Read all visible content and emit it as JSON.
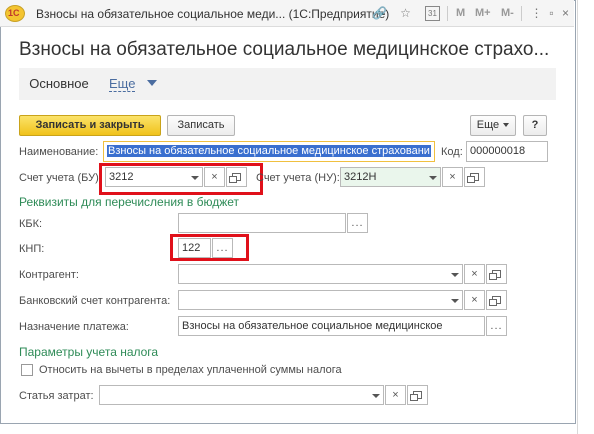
{
  "window": {
    "logo_text": "1С",
    "title": "Взносы на обязательное социальное меди... (1С:Предприятие)",
    "toolbar_m": [
      "M",
      "M+",
      "M-"
    ]
  },
  "form": {
    "title": "Взносы на обязательное социальное медицинское страхо...",
    "tab_main": "Основное",
    "tab_more": "Еще"
  },
  "commands": {
    "save_close": "Записать и закрыть",
    "save": "Записать",
    "more": "Еще",
    "help": "?"
  },
  "fields": {
    "name_label": "Наименование:",
    "name_value": "Взносы на обязательное социальное медицинское страховани",
    "code_label": "Код:",
    "code_value": "000000018",
    "acc_bu_label": "Счет учета (БУ):",
    "acc_bu_value": "3212",
    "acc_nu_label": "Счет учета (НУ):",
    "acc_nu_value": "3212Н",
    "kbk_label": "КБК:",
    "kbk_value": "",
    "knp_label": "КНП:",
    "knp_value": "122",
    "contractor_label": "Контрагент:",
    "contractor_value": "",
    "bank_label": "Банковский счет контрагента:",
    "bank_value": "",
    "purpose_label": "Назначение платежа:",
    "purpose_value": "Взносы на обязательное социальное медицинское",
    "deduct_label": "Относить на вычеты в пределах уплаченной суммы налога",
    "deduct_checked": false,
    "cost_label": "Статья затрат:",
    "cost_value": ""
  },
  "sections": {
    "budget": "Реквизиты для перечисления в бюджет",
    "tax": "Параметры учета налога"
  },
  "icons": {
    "clear": "×",
    "select": "...",
    "close": "×"
  },
  "colors": {
    "primary_button": "#f0c21b",
    "section_text": "#2e8b57",
    "highlight": "#e0101a",
    "link": "#4b6da0"
  }
}
